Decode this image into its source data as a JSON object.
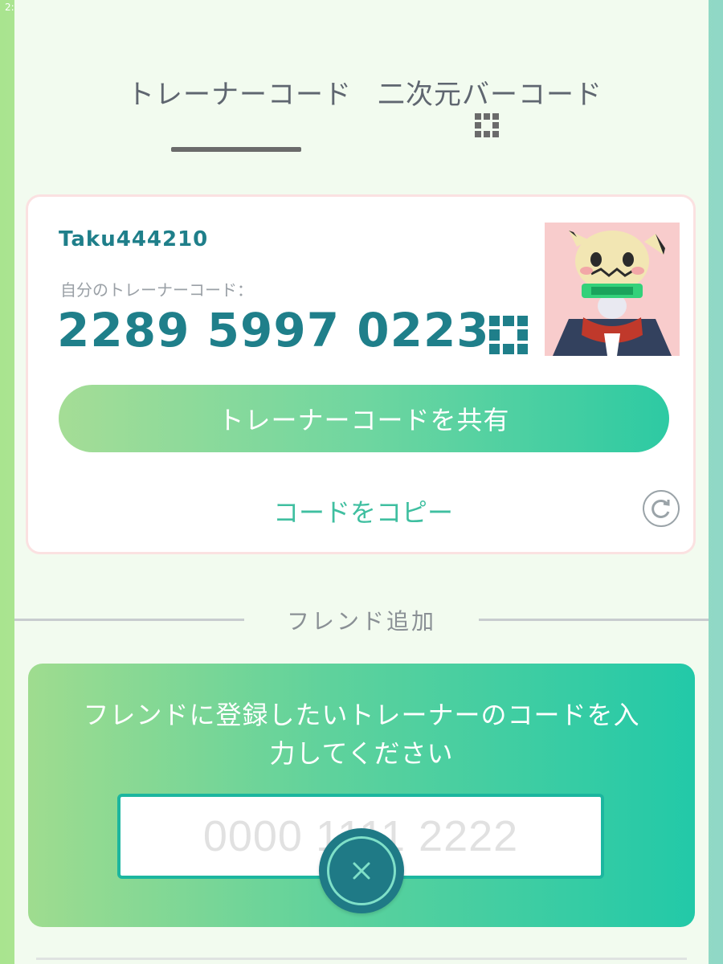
{
  "status_bar": {
    "time": "2:"
  },
  "tabs": [
    {
      "label": "トレーナーコード",
      "active": true
    },
    {
      "label": "二次元バーコード",
      "icon": "qr-code-icon"
    }
  ],
  "trainer_card": {
    "username": "Taku444210",
    "code_label": "自分のトレーナーコード：",
    "code": "2289 5997 0223",
    "share_button": "トレーナーコードを共有",
    "copy_link": "コードをコピー",
    "icons": {
      "qr": "qr-code-icon",
      "refresh": "refresh-icon",
      "avatar": "trainer-avatar"
    }
  },
  "add_friend": {
    "section_title": "フレンド追加",
    "prompt": "フレンドに登録したいトレーナーのコードを入力してください",
    "input_placeholder": "0000 1111 2222",
    "input_value": "",
    "close_icon": "close-icon"
  },
  "colors": {
    "accent_teal": "#1f7f8a",
    "accent_green": "#3fbfa0",
    "gradient_start": "#a5dd96",
    "gradient_end": "#2dcaa3"
  }
}
